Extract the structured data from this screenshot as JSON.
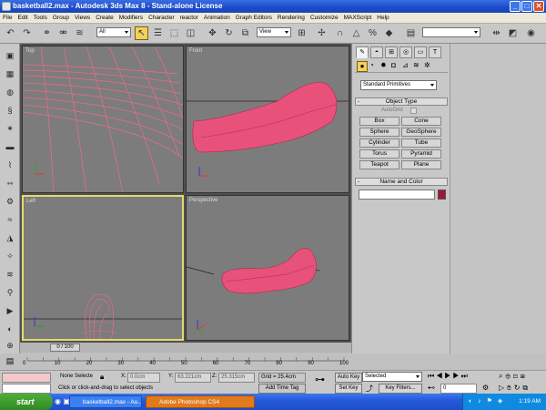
{
  "window": {
    "title": "basketball2.max - Autodesk 3ds Max 8  - Stand-alone License",
    "minimize": "_",
    "maximize": "□",
    "close": "✕"
  },
  "menu": [
    "File",
    "Edit",
    "Tools",
    "Group",
    "Views",
    "Create",
    "Modifiers",
    "Character",
    "reactor",
    "Animation",
    "Graph Editors",
    "Rendering",
    "Customize",
    "MAXScript",
    "Help"
  ],
  "toolbar": {
    "selection_filter": "All",
    "reference_coord": "View",
    "named_selection": ""
  },
  "viewports": {
    "top": "Top",
    "front": "Front",
    "left": "Left",
    "perspective": "Perspective"
  },
  "command_panel": {
    "category": "Standard Primitives",
    "object_type_header": "Object Type",
    "autogrid": "AutoGrid",
    "buttons": [
      "Box",
      "Cone",
      "Sphere",
      "GeoSphere",
      "Cylinder",
      "Tube",
      "Torus",
      "Pyramid",
      "Teapot",
      "Plane"
    ],
    "name_color_header": "Name and Color",
    "object_color": "#9b1a3a",
    "minus": "-"
  },
  "timeline": {
    "slider": "0 / 100",
    "ticks": [
      "0",
      "10",
      "20",
      "30",
      "40",
      "50",
      "60",
      "70",
      "80",
      "90",
      "100"
    ]
  },
  "status": {
    "selection": "None Selecte",
    "x_label": "X:",
    "x_value": "0.0cm",
    "y_label": "Y:",
    "y_value": "63.221cm",
    "z_label": "Z:",
    "z_value": "25.315cm",
    "grid": "Grid = 25.4cm",
    "prompt": "Click or click-and-drag to select objects",
    "add_time_tag": "Add Time Tag",
    "auto_key": "Auto Key",
    "set_key": "Set Key",
    "selected": "Selected",
    "key_filters": "Key Filters...",
    "frame": "0"
  },
  "taskbar": {
    "start": "start",
    "tasks": [
      "basketball2.max - Au...",
      "Adobe Photoshop CS4"
    ],
    "time": "1:19 AM"
  },
  "colors": {
    "object_pink": "#e8527a",
    "active_viewport": "#e6d96b"
  }
}
